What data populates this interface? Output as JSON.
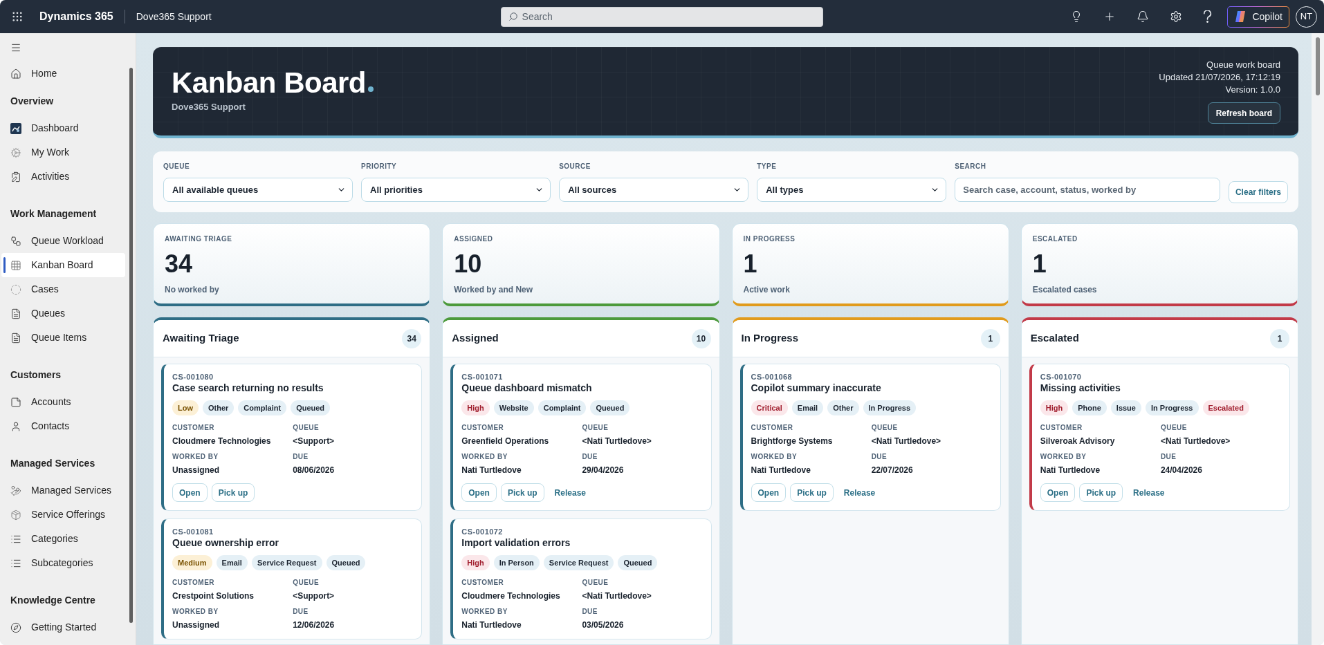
{
  "topbar": {
    "app_name": "Dynamics 365",
    "area": "Dove365 Support",
    "search": {
      "placeholder": "Search"
    },
    "copilot": "Copilot",
    "avatar": "NT"
  },
  "sidebar": {
    "sections": [
      {
        "items": [
          {
            "label": "Home",
            "selected": false
          }
        ]
      },
      {
        "heading": "Overview",
        "items": [
          {
            "label": "Dashboard",
            "selected": false
          },
          {
            "label": "My Work",
            "selected": false
          },
          {
            "label": "Activities",
            "selected": false
          }
        ]
      },
      {
        "heading": "Work Management",
        "items": [
          {
            "label": "Queue Workload",
            "selected": false
          },
          {
            "label": "Kanban Board",
            "selected": true
          },
          {
            "label": "Cases",
            "selected": false
          },
          {
            "label": "Queues",
            "selected": false
          },
          {
            "label": "Queue Items",
            "selected": false
          }
        ]
      },
      {
        "heading": "Customers",
        "items": [
          {
            "label": "Accounts",
            "selected": false
          },
          {
            "label": "Contacts",
            "selected": false
          }
        ]
      },
      {
        "heading": "Managed Services",
        "items": [
          {
            "label": "Managed Services",
            "selected": false
          },
          {
            "label": "Service Offerings",
            "selected": false
          },
          {
            "label": "Categories",
            "selected": false
          },
          {
            "label": "Subcategories",
            "selected": false
          }
        ]
      },
      {
        "heading": "Knowledge Centre",
        "items": [
          {
            "label": "Getting Started",
            "selected": false
          }
        ]
      }
    ]
  },
  "banner": {
    "title": "Kanban Board",
    "subtitle": "Dove365 Support",
    "meta": [
      "Queue work board",
      "Updated 21/07/2026, 17:12:19",
      "Version: 1.0.0"
    ],
    "refresh_button": "Refresh board"
  },
  "filters": {
    "fields": [
      {
        "kind": "select",
        "label": "QUEUE",
        "value": "All available queues"
      },
      {
        "kind": "select",
        "label": "PRIORITY",
        "value": "All priorities"
      },
      {
        "kind": "select",
        "label": "SOURCE",
        "value": "All sources"
      },
      {
        "kind": "select",
        "label": "TYPE",
        "value": "All types"
      },
      {
        "kind": "search",
        "label": "SEARCH",
        "placeholder": "Search case, account, status, worked by"
      }
    ],
    "clear_button": "Clear filters"
  },
  "stats": [
    {
      "label": "AWAITING TRIAGE",
      "value": "34",
      "caption": "No worked by",
      "color": "#2e6d85"
    },
    {
      "label": "ASSIGNED",
      "value": "10",
      "caption": "Worked by and New",
      "color": "#4c9a3b"
    },
    {
      "label": "IN PROGRESS",
      "value": "1",
      "caption": "Active work",
      "color": "#e19b1c"
    },
    {
      "label": "ESCALATED",
      "value": "1",
      "caption": "Escalated cases",
      "color": "#c23a48"
    }
  ],
  "columns": [
    {
      "title": "Awaiting Triage",
      "count": "34",
      "color": "#2e6d85",
      "cards": [
        {
          "id": "CS-001080",
          "title": "Case search returning no results",
          "escalated": false,
          "tags": [
            {
              "label": "Low",
              "kind": "warning"
            },
            {
              "label": "Other",
              "kind": "neutral"
            },
            {
              "label": "Complaint",
              "kind": "neutral"
            },
            {
              "label": "Queued",
              "kind": "neutral"
            }
          ],
          "fields": [
            {
              "label": "CUSTOMER",
              "value": "Cloudmere Technologies"
            },
            {
              "label": "QUEUE",
              "value": "<Support>"
            },
            {
              "label": "WORKED BY",
              "value": "Unassigned"
            },
            {
              "label": "DUE",
              "value": "08/06/2026"
            }
          ],
          "actions": [
            {
              "label": "Open",
              "kind": "outline"
            },
            {
              "label": "Pick up",
              "kind": "outline"
            }
          ]
        },
        {
          "id": "CS-001081",
          "title": "Queue ownership error",
          "escalated": false,
          "tags": [
            {
              "label": "Medium",
              "kind": "warning"
            },
            {
              "label": "Email",
              "kind": "neutral"
            },
            {
              "label": "Service Request",
              "kind": "neutral"
            },
            {
              "label": "Queued",
              "kind": "neutral"
            }
          ],
          "fields": [
            {
              "label": "CUSTOMER",
              "value": "Crestpoint Solutions"
            },
            {
              "label": "QUEUE",
              "value": "<Support>"
            },
            {
              "label": "WORKED BY",
              "value": "Unassigned"
            },
            {
              "label": "DUE",
              "value": "12/06/2026"
            }
          ]
        }
      ]
    },
    {
      "title": "Assigned",
      "count": "10",
      "color": "#4c9a3b",
      "cards": [
        {
          "id": "CS-001071",
          "title": "Queue dashboard mismatch",
          "escalated": false,
          "tags": [
            {
              "label": "High",
              "kind": "danger"
            },
            {
              "label": "Website",
              "kind": "neutral"
            },
            {
              "label": "Complaint",
              "kind": "neutral"
            },
            {
              "label": "Queued",
              "kind": "neutral"
            }
          ],
          "fields": [
            {
              "label": "CUSTOMER",
              "value": "Greenfield Operations"
            },
            {
              "label": "QUEUE",
              "value": "<Nati Turtledove>"
            },
            {
              "label": "WORKED BY",
              "value": "Nati Turtledove"
            },
            {
              "label": "DUE",
              "value": "29/04/2026"
            }
          ],
          "actions": [
            {
              "label": "Open",
              "kind": "outline"
            },
            {
              "label": "Pick up",
              "kind": "outline"
            },
            {
              "label": "Release",
              "kind": "link"
            }
          ]
        },
        {
          "id": "CS-001072",
          "title": "Import validation errors",
          "escalated": false,
          "tags": [
            {
              "label": "High",
              "kind": "danger"
            },
            {
              "label": "In Person",
              "kind": "neutral"
            },
            {
              "label": "Service Request",
              "kind": "neutral"
            },
            {
              "label": "Queued",
              "kind": "neutral"
            }
          ],
          "fields": [
            {
              "label": "CUSTOMER",
              "value": "Cloudmere Technologies"
            },
            {
              "label": "QUEUE",
              "value": "<Nati Turtledove>"
            },
            {
              "label": "WORKED BY",
              "value": "Nati Turtledove"
            },
            {
              "label": "DUE",
              "value": "03/05/2026"
            }
          ]
        }
      ]
    },
    {
      "title": "In Progress",
      "count": "1",
      "color": "#e19b1c",
      "cards": [
        {
          "id": "CS-001068",
          "title": "Copilot summary inaccurate",
          "escalated": false,
          "tags": [
            {
              "label": "Critical",
              "kind": "danger"
            },
            {
              "label": "Email",
              "kind": "neutral"
            },
            {
              "label": "Other",
              "kind": "neutral"
            },
            {
              "label": "In Progress",
              "kind": "neutral"
            }
          ],
          "fields": [
            {
              "label": "CUSTOMER",
              "value": "Brightforge Systems"
            },
            {
              "label": "QUEUE",
              "value": "<Nati Turtledove>"
            },
            {
              "label": "WORKED BY",
              "value": "Nati Turtledove"
            },
            {
              "label": "DUE",
              "value": "22/07/2026"
            }
          ],
          "actions": [
            {
              "label": "Open",
              "kind": "outline"
            },
            {
              "label": "Pick up",
              "kind": "outline"
            },
            {
              "label": "Release",
              "kind": "link"
            }
          ]
        }
      ]
    },
    {
      "title": "Escalated",
      "count": "1",
      "color": "#c23a48",
      "cards": [
        {
          "id": "CS-001070",
          "title": "Missing activities",
          "escalated": true,
          "tags": [
            {
              "label": "High",
              "kind": "danger"
            },
            {
              "label": "Phone",
              "kind": "neutral"
            },
            {
              "label": "Issue",
              "kind": "neutral"
            },
            {
              "label": "In Progress",
              "kind": "neutral"
            },
            {
              "label": "Escalated",
              "kind": "danger"
            }
          ],
          "fields": [
            {
              "label": "CUSTOMER",
              "value": "Silveroak Advisory"
            },
            {
              "label": "QUEUE",
              "value": "<Nati Turtledove>"
            },
            {
              "label": "WORKED BY",
              "value": "Nati Turtledove"
            },
            {
              "label": "DUE",
              "value": "24/04/2026"
            }
          ],
          "actions": [
            {
              "label": "Open",
              "kind": "outline"
            },
            {
              "label": "Pick up",
              "kind": "outline"
            },
            {
              "label": "Release",
              "kind": "link"
            }
          ]
        }
      ]
    }
  ]
}
